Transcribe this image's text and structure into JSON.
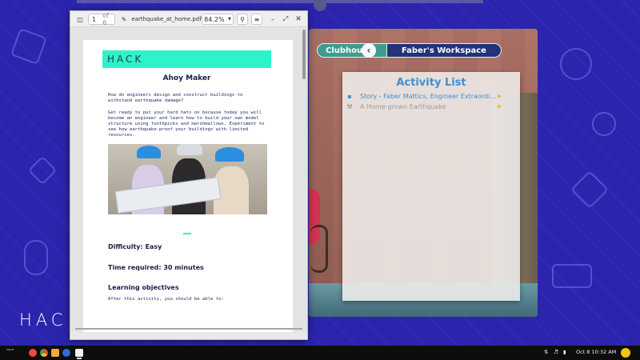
{
  "desktop": {
    "watermark": "HACK"
  },
  "pdf_viewer": {
    "page_current": "1",
    "page_total": "of 6",
    "filename": "earthquake_at_home.pdf",
    "zoom": "84.2%",
    "icons": [
      "sidebar-icon",
      "edit-icon",
      "search-icon",
      "menu-icon",
      "minimize-icon",
      "restore-icon",
      "close-icon"
    ],
    "document": {
      "header_band": "HACK",
      "title": "Ahoy Maker",
      "intro": "How do engineers design and construct buildings to withstand earthquake damage?",
      "body": "Get ready to put your hard hats on because today you will become an engineer and learn how to build your own model structure using toothpicks and marshmallows. Experiment to see how earthquake-proof your buildings with limited resources.",
      "difficulty": "Difficulty: Easy",
      "time_required": "Time required: 30 minutes",
      "objectives_heading": "Learning objectives",
      "objectives_intro": "After this activity, you should be able to:"
    }
  },
  "clubhouse": {
    "breadcrumb": {
      "home": "Clubhouse",
      "current": "Faber's Workspace"
    },
    "activity_list": {
      "title": "Activity List",
      "items": [
        {
          "label": "Story - Faber Mattics, Engineer Extraordi…",
          "icon": "story-icon",
          "color": "#3f8fd0"
        },
        {
          "label": "A Home-grown Earthquake",
          "icon": "tools-icon",
          "color": "#9b9b9b"
        }
      ]
    }
  },
  "taskbar": {
    "clock": "Oct 8  10:32 AM",
    "apps": [
      "hack-logo",
      "chrome-icon",
      "app-icon",
      "files-icon",
      "store-icon",
      "document-icon"
    ]
  },
  "colors": {
    "desktop_bg": "#2b25ad",
    "accent_teal": "#2ff3c8",
    "clubhouse_teal": "#3f9b8f",
    "workspace_navy": "#243278",
    "activity_title_blue": "#3f8fd0"
  }
}
